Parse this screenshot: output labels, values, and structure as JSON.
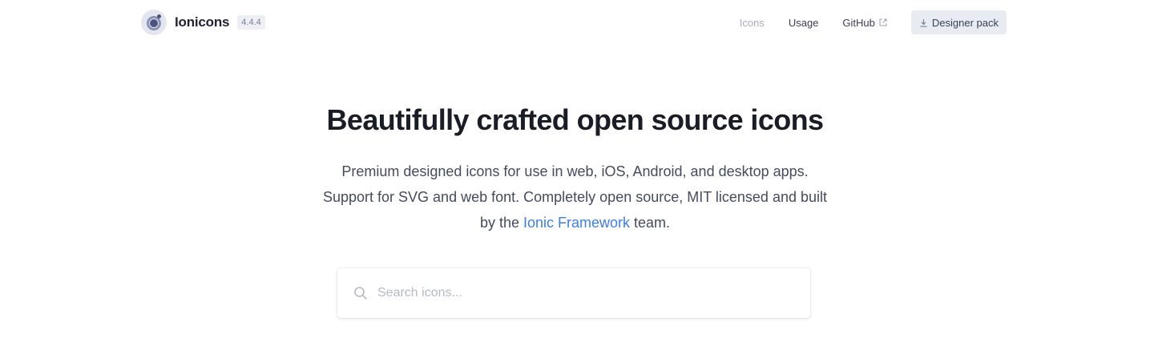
{
  "brand": {
    "name": "Ionicons",
    "version": "4.4.4"
  },
  "nav": {
    "icons_label": "Icons",
    "usage_label": "Usage",
    "github_label": "GitHub",
    "designer_pack_label": "Designer pack"
  },
  "hero": {
    "title": "Beautifully crafted open source icons",
    "sub_before": "Premium designed icons for use in web, iOS, Android, and desktop apps. Support for SVG and web font. Completely open source, MIT licensed and built by the ",
    "link_label": "Ionic Framework",
    "sub_after": " team."
  },
  "search": {
    "placeholder": "Search icons..."
  },
  "colors": {
    "accent_link": "#3d7eea",
    "active_nav": "#a7adbd",
    "button_bg": "#e8ebf2"
  },
  "icons": [
    "ionicons-logo-icon",
    "external-link-icon",
    "download-icon",
    "search-icon"
  ]
}
